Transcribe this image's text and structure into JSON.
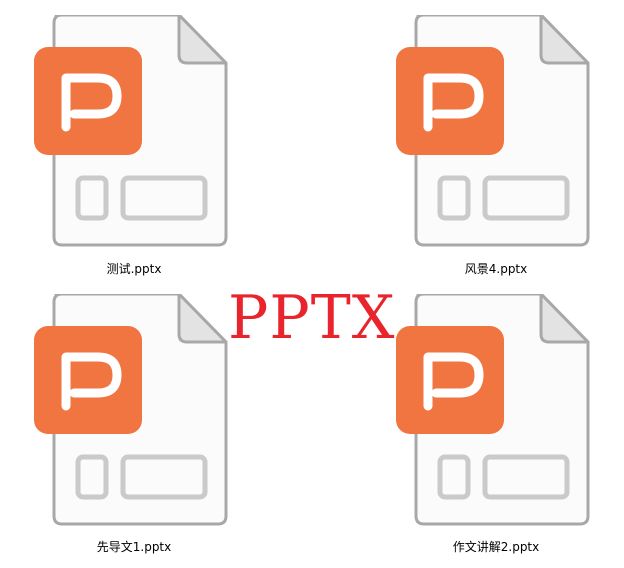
{
  "files": [
    {
      "name": "测试.pptx",
      "icon": "powerpoint-file-icon"
    },
    {
      "name": "风景4.pptx",
      "icon": "powerpoint-file-icon"
    },
    {
      "name": "先导文1.pptx",
      "icon": "powerpoint-file-icon"
    },
    {
      "name": "作文讲解2.pptx",
      "icon": "powerpoint-file-icon"
    }
  ],
  "watermark": {
    "text": "PPTX"
  },
  "colors": {
    "badge": "#f07540",
    "page_fill": "#fbfbfb",
    "page_stroke": "#a8a8a8",
    "fold_fill": "#e3e3e3",
    "slot_stroke": "#cacaca",
    "watermark": "#e8242c"
  }
}
